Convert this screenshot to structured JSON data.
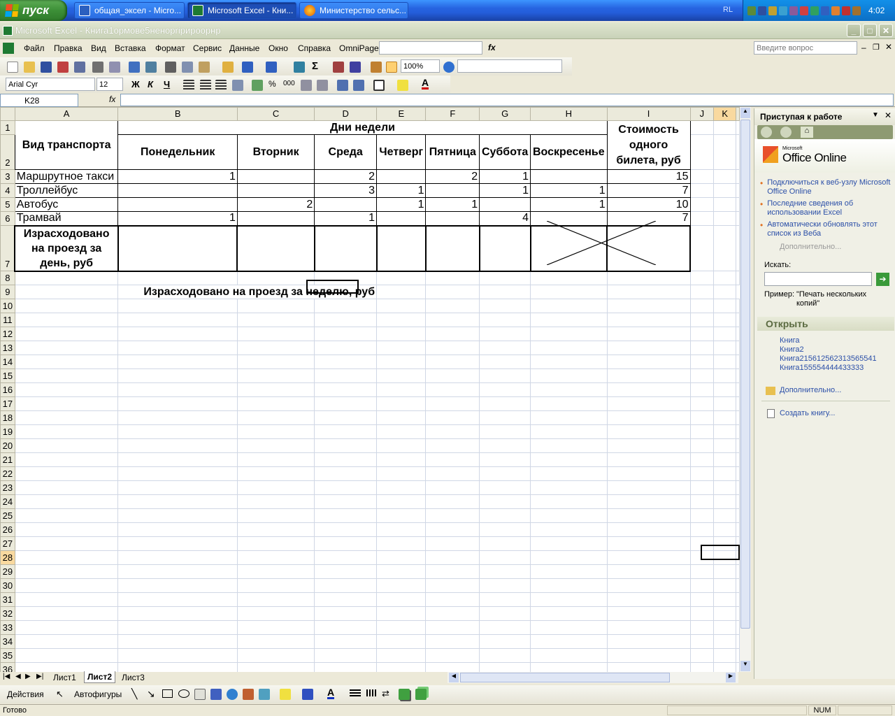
{
  "taskbar": {
    "start_label": "пуск",
    "tasks": [
      "общая_эксел - Micro...",
      "Microsoft Excel - Кни...",
      "Министерство сельс..."
    ],
    "lang": "RL",
    "clock": "4:02"
  },
  "window": {
    "title": "Microsoft Excel - Книга1ормове5ненорripироорнр"
  },
  "menu": {
    "items": [
      "Файл",
      "Правка",
      "Вид",
      "Вставка",
      "Формат",
      "Сервис",
      "Данные",
      "Окно",
      "Справка",
      "OmniPage"
    ],
    "help_placeholder": "Введите вопрос"
  },
  "toolbar": {
    "zoom": "100%",
    "font": "Arial Cyr",
    "size": "12"
  },
  "formula": {
    "cell_ref": "K28",
    "fx": "fx"
  },
  "columns": [
    "A",
    "B",
    "C",
    "D",
    "E",
    "F",
    "G",
    "H",
    "I",
    "J",
    "K"
  ],
  "rows": [
    "1",
    "2",
    "3",
    "4",
    "5",
    "6",
    "7",
    "8",
    "9",
    "10",
    "11",
    "12",
    "13",
    "14",
    "15",
    "16",
    "17",
    "18",
    "19",
    "20",
    "21",
    "22",
    "23",
    "24",
    "25",
    "26",
    "27",
    "28",
    "29",
    "30",
    "31",
    "32",
    "33",
    "34",
    "35",
    "36"
  ],
  "sheet": {
    "vid": "Вид транспорта",
    "days_header": "Дни недели",
    "days": [
      "Понедельник",
      "Вторник",
      "Среда",
      "Четверг",
      "Пятница",
      "Суббота",
      "Воскресенье"
    ],
    "cost_header": "Стоимость одного билета, руб",
    "data": [
      {
        "name": "Маршрутное такси",
        "vals": [
          "1",
          "",
          "2",
          "",
          "2",
          "1",
          ""
        ],
        "cost": "15"
      },
      {
        "name": "Троллейбус",
        "vals": [
          "",
          "",
          "3",
          "1",
          "",
          "1",
          "1"
        ],
        "cost": "7"
      },
      {
        "name": "Автобус",
        "vals": [
          "",
          "2",
          "",
          "1",
          "1",
          "",
          "1"
        ],
        "cost": "10"
      },
      {
        "name": "Трамвай",
        "vals": [
          "1",
          "",
          "1",
          "",
          "",
          "4",
          ""
        ],
        "cost": "7"
      }
    ],
    "spent_day": "Израсходовано на проезд за день, руб",
    "spent_week": "Израсходовано на проезд за неделю, руб"
  },
  "tabs": [
    "Лист1",
    "Лист2",
    "Лист3"
  ],
  "pane": {
    "title": "Приступая к работе",
    "brand_small": "Microsoft",
    "brand": "Office Online",
    "links": [
      "Подключиться к веб-узлу Microsoft Office Online",
      "Последние сведения об использовании Excel",
      "Автоматически обновлять этот список из Веба"
    ],
    "more": "Дополнительно...",
    "search_label": "Искать:",
    "example_label": "Пример:",
    "example_text": "\"Печать нескольких копий\"",
    "open_header": "Открыть",
    "files": [
      "Книга",
      "Книга2",
      "Книга215612562313565541",
      "Книга155554444433333"
    ],
    "open_more": "Дополнительно...",
    "create": "Создать книгу..."
  },
  "drawbar": {
    "actions": "Действия",
    "autoshapes": "Автофигуры"
  },
  "status": {
    "ready": "Готово",
    "num": "NUM"
  }
}
